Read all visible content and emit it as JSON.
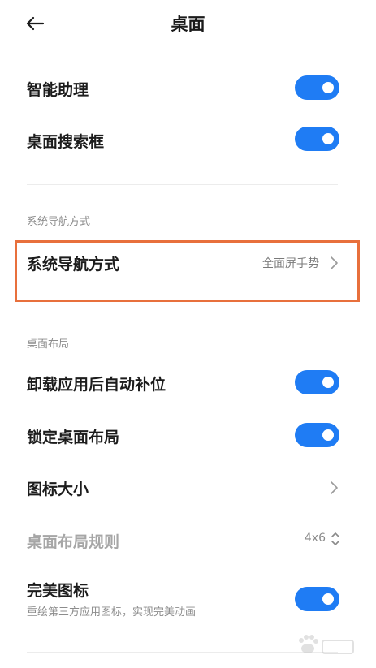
{
  "header": {
    "title": "桌面",
    "back_icon": "arrow-left-icon"
  },
  "top_settings": [
    {
      "label": "智能助理",
      "toggle": "on"
    },
    {
      "label": "桌面搜索框",
      "toggle": "on"
    }
  ],
  "nav_section": {
    "heading": "系统导航方式",
    "item": {
      "label": "系统导航方式",
      "value": "全面屏手势",
      "icon": "chevron-right-icon"
    }
  },
  "layout_section": {
    "heading": "桌面布局",
    "items": [
      {
        "label": "卸载应用后自动补位",
        "toggle": "on"
      },
      {
        "label": "锁定桌面布局",
        "toggle": "on"
      },
      {
        "label": "图标大小",
        "icon": "chevron-right-icon"
      },
      {
        "label": "桌面布局规则",
        "value": "4x6",
        "icon": "up-down-chevron-icon",
        "state": "disabled"
      },
      {
        "label": "完美图标",
        "sublabel": "重绘第三方应用图标，实现完美动画",
        "toggle": "on"
      }
    ]
  },
  "colors": {
    "accent": "#1f7cf4",
    "highlight": "#e8703c",
    "text_primary": "#1c1c1c",
    "text_secondary": "#8c8c8c",
    "text_disabled": "#a6a6a6"
  },
  "watermark": {
    "icon": "paw-watermark-icon"
  }
}
